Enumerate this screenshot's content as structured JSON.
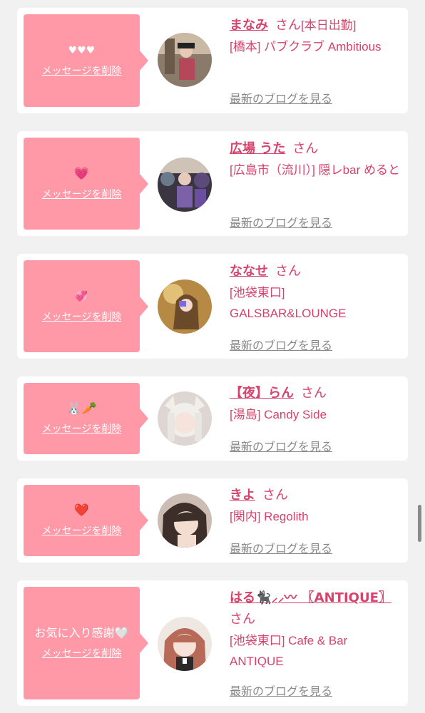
{
  "favorites": [
    {
      "message": "♥♥♥",
      "delete_label": "メッセージを削除",
      "name": "まなみ",
      "suffix": "さん",
      "status": "[本日出勤]",
      "shop": "[橋本] パブクラブ Ambitious",
      "blog_label": "最新のブログを見る"
    },
    {
      "message": "💗",
      "delete_label": "メッセージを削除",
      "name": "広場 うた",
      "suffix": "さん",
      "status": "",
      "shop": "[広島市（流川）] 隠レbar めると",
      "blog_label": "最新のブログを見る"
    },
    {
      "message": "💞",
      "delete_label": "メッセージを削除",
      "name": "ななせ",
      "suffix": "さん",
      "status": "",
      "shop": "[池袋東口] GALSBAR&LOUNGE",
      "blog_label": "最新のブログを見る"
    },
    {
      "message": "🐰🥕",
      "delete_label": "メッセージを削除",
      "name": "【夜】らん",
      "suffix": "さん",
      "status": "",
      "shop": "[湯島] Candy Side",
      "blog_label": "最新のブログを見る"
    },
    {
      "message": "❤️",
      "delete_label": "メッセージを削除",
      "name": "きよ",
      "suffix": "さん",
      "status": "",
      "shop": "[関内] Regolith",
      "blog_label": "最新のブログを見る"
    },
    {
      "message": "お気に入り感謝🤍",
      "delete_label": "メッセージを削除",
      "name": "はる🐈‍⬛⸝⸝〰︎ 〖ANTIQUE〗",
      "suffix": "さん",
      "status": "",
      "shop": "[池袋東口] Cafe & Bar ANTIQUE",
      "blog_label": "最新のブログを見る"
    }
  ]
}
